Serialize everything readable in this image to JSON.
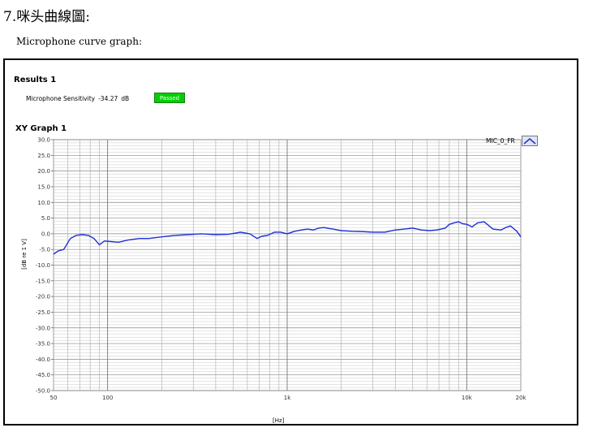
{
  "page": {
    "heading": "7.咪头曲線圖:",
    "subheading": "Microphone curve graph:"
  },
  "results": {
    "title": "Results 1",
    "sensitivity_label": "Microphone Sensitivity",
    "sensitivity_value": "-34.27",
    "sensitivity_unit": "dB",
    "status": "Passed",
    "status_color": "#00d000"
  },
  "graph": {
    "title": "XY Graph 1",
    "legend_label": "MIC_0_FR",
    "ylabel": "[dB re 1 V]",
    "xlabel": "[Hz]"
  },
  "chart_data": {
    "type": "line",
    "title": "XY Graph 1",
    "xlabel": "[Hz]",
    "ylabel": "[dB re 1 V]",
    "x_scale": "log",
    "xlim": [
      50,
      20000
    ],
    "ylim": [
      -50,
      30
    ],
    "y_ticks": [
      "30.0",
      "25.0",
      "20.0",
      "15.0",
      "10.0",
      "5.0",
      "0.0",
      "-5.0",
      "-10.0",
      "-15.0",
      "-20.0",
      "-25.0",
      "-30.0",
      "-35.0",
      "-40.0",
      "-45.0",
      "-50.0"
    ],
    "x_ticks": [
      "50",
      "100",
      "1k",
      "10k",
      "20k"
    ],
    "grid": true,
    "legend_position": "top-right",
    "series": [
      {
        "name": "MIC_0_FR",
        "color": "#1f2fd6",
        "x": [
          50,
          53,
          57,
          62,
          67,
          72,
          78,
          84,
          90,
          96,
          105,
          115,
          130,
          150,
          170,
          200,
          240,
          280,
          330,
          400,
          470,
          550,
          620,
          680,
          720,
          780,
          850,
          920,
          1000,
          1100,
          1200,
          1300,
          1400,
          1500,
          1600,
          1700,
          1800,
          2000,
          2300,
          2600,
          3000,
          3500,
          4000,
          4500,
          5000,
          5600,
          6200,
          6800,
          7200,
          7600,
          8000,
          8500,
          9000,
          9500,
          10000,
          10700,
          11500,
          12500,
          14000,
          15500,
          16500,
          17500,
          19000,
          20000
        ],
        "values": [
          -6.5,
          -5.5,
          -5.0,
          -1.5,
          -0.5,
          -0.3,
          -0.5,
          -1.5,
          -3.5,
          -2.3,
          -2.5,
          -2.7,
          -2.0,
          -1.5,
          -1.5,
          -1.0,
          -0.5,
          -0.3,
          0.0,
          -0.3,
          -0.2,
          0.5,
          0.0,
          -1.5,
          -0.8,
          -0.5,
          0.5,
          0.5,
          0.0,
          0.8,
          1.2,
          1.5,
          1.2,
          1.8,
          2.0,
          1.7,
          1.5,
          1.0,
          0.8,
          0.7,
          0.5,
          0.5,
          1.2,
          1.5,
          1.8,
          1.2,
          1.0,
          1.2,
          1.5,
          1.8,
          3.0,
          3.5,
          3.8,
          3.2,
          3.0,
          2.2,
          3.5,
          3.8,
          1.5,
          1.2,
          2.0,
          2.5,
          0.8,
          -1.0
        ]
      }
    ]
  }
}
